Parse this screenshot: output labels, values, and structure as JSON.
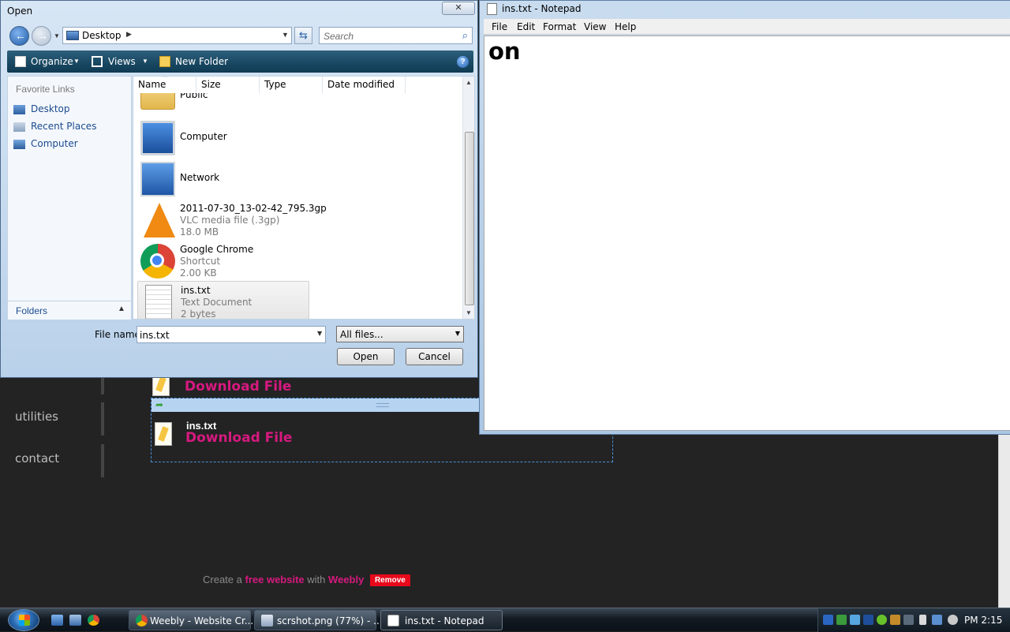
{
  "site": {
    "nav": [
      "utilities",
      "contact"
    ],
    "files": [
      {
        "download_label": "Download File"
      },
      {
        "title": "ins.txt",
        "download_label": "Download File"
      }
    ],
    "footer": {
      "prefix": "Create a",
      "free_website": "free website",
      "with": "with",
      "brand": "Weebly",
      "remove": "Remove"
    }
  },
  "notepad": {
    "title": "ins.txt - Notepad",
    "menu": [
      "File",
      "Edit",
      "Format",
      "View",
      "Help"
    ],
    "content": "on"
  },
  "dialog": {
    "title": "Open",
    "close": "✕",
    "address": "Desktop",
    "search_placeholder": "Search",
    "toolbar": {
      "organize": "Organize",
      "views": "Views",
      "new_folder": "New Folder",
      "help": "?"
    },
    "favorites": {
      "heading": "Favorite Links",
      "items": [
        "Desktop",
        "Recent Places",
        "Computer"
      ],
      "folders_label": "Folders"
    },
    "columns": [
      "Name",
      "Size",
      "Type",
      "Date modified"
    ],
    "files": [
      {
        "name": "Public",
        "icon": "folder-icon"
      },
      {
        "name": "Computer",
        "icon": "computer-icon"
      },
      {
        "name": "Network",
        "icon": "network-icon"
      },
      {
        "name": "2011-07-30_13-02-42_795.3gp",
        "type": "VLC media file (.3gp)",
        "size": "18.0 MB",
        "icon": "vlc-icon"
      },
      {
        "name": "Google Chrome",
        "type": "Shortcut",
        "size": "2.00 KB",
        "icon": "chrome-icon"
      },
      {
        "name": "ins.txt",
        "type": "Text Document",
        "size": "2 bytes",
        "icon": "text-document-icon",
        "selected": true
      }
    ],
    "file_name_label": "File name:",
    "file_name_value": "ins.txt",
    "filter_value": "All files...",
    "open_button": "Open",
    "cancel_button": "Cancel"
  },
  "taskbar": {
    "tasks": [
      {
        "label": "Weebly - Website Cr...",
        "icon": "chrome-icon"
      },
      {
        "label": "scrshot.png (77%) - ...",
        "icon": "image-editor-icon"
      },
      {
        "label": "ins.txt - Notepad",
        "icon": "notepad-icon",
        "active": true
      }
    ],
    "clock": "PM 2:15"
  },
  "colors": {
    "accent_pink": "#d6197f",
    "remove_red": "#e8081b",
    "link_blue": "#1c4a8f"
  }
}
